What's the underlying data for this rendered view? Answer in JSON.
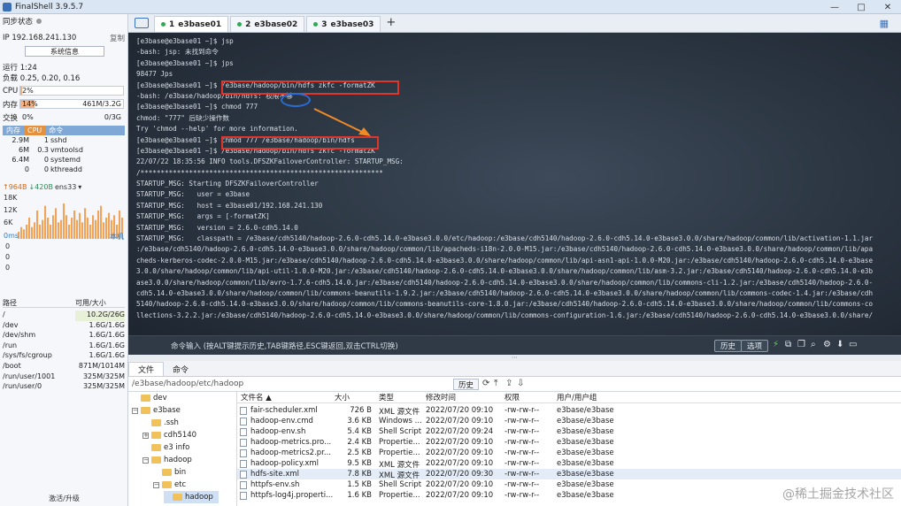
{
  "window": {
    "title": "FinalShell 3.9.5.7",
    "controls": [
      "—",
      "□",
      "✕"
    ]
  },
  "left_panel": {
    "sync_status": "同步状态",
    "ip": "IP 192.168.241.130",
    "copy": "复制",
    "sysinfo_button": "系统信息",
    "uptime": "运行 1:24",
    "load": "负载 0.25, 0.20, 0.16",
    "cpu": {
      "label": "CPU",
      "value": "2%",
      "percent": 2
    },
    "mem": {
      "label": "内存",
      "value": "14%",
      "detail": "461M/3.2G",
      "percent": 14
    },
    "swap": {
      "label": "交换",
      "value": "0%",
      "detail": "0/3G",
      "percent": 0
    },
    "proc_headers": [
      "内存",
      "CPU",
      "命令"
    ],
    "processes": [
      {
        "mem": "2.9M",
        "cpu": "1",
        "cmd": "sshd"
      },
      {
        "mem": "6M",
        "cpu": "0.3",
        "cmd": "vmtoolsd"
      },
      {
        "mem": "6.4M",
        "cpu": "0",
        "cmd": "systemd"
      },
      {
        "mem": "0",
        "cpu": "0",
        "cmd": "kthreadd"
      }
    ],
    "net": {
      "up": "↑964B",
      "down": "↓420B",
      "iface": "ens33",
      "dropdown": "▾"
    },
    "chart_labels": [
      "18K",
      "12K",
      "6K"
    ],
    "latency": {
      "label": "0ms",
      "host": "本机",
      "values": [
        "0",
        "0",
        "0"
      ]
    },
    "disk_headers": [
      "路径",
      "可用/大小"
    ],
    "disks": [
      {
        "path": "/",
        "value": "10.2G/26G"
      },
      {
        "path": "/dev",
        "value": "1.6G/1.6G"
      },
      {
        "path": "/dev/shm",
        "value": "1.6G/1.6G"
      },
      {
        "path": "/run",
        "value": "1.6G/1.6G"
      },
      {
        "path": "/sys/fs/cgroup",
        "value": "1.6G/1.6G"
      },
      {
        "path": "/boot",
        "value": "871M/1014M"
      },
      {
        "path": "/run/user/1001",
        "value": "325M/325M"
      },
      {
        "path": "/run/user/0",
        "value": "325M/325M"
      }
    ],
    "upgrade": "激活/升级"
  },
  "tabs": [
    {
      "num": "1",
      "label": "e3base01",
      "active": true
    },
    {
      "num": "2",
      "label": "e3base02",
      "active": false
    },
    {
      "num": "3",
      "label": "e3base03",
      "active": false
    }
  ],
  "terminal": {
    "lines": [
      "[e3base@e3base01 ~]$ jsp",
      "-bash: jsp: 未找到命令",
      "[e3base@e3base01 ~]$ jps",
      "98477 Jps",
      "[e3base@e3base01 ~]$ /e3base/hadoop/bin/hdfs zkfc -formatZK",
      "-bash: /e3base/hadoop/bin/hdfs: 权限不够",
      "[e3base@e3base01 ~]$ chmod 777",
      "chmod: \"777\" 后缺少操作数",
      "Try 'chmod --help' for more information.",
      "[e3base@e3base01 ~]$ chmod 777 /e3base/hadoop/bin/hdfs",
      "[e3base@e3base01 ~]$ /e3base/hadoop/bin/hdfs zkfc -formatZK",
      "22/07/22 18:35:56 INFO tools.DFSZKFailoverController: STARTUP_MSG:",
      "/************************************************************",
      "STARTUP_MSG: Starting DFSZKFailoverController",
      "STARTUP_MSG:   user = e3base",
      "STARTUP_MSG:   host = e3base01/192.168.241.130",
      "STARTUP_MSG:   args = [-formatZK]",
      "STARTUP_MSG:   version = 2.6.0-cdh5.14.0",
      "STARTUP_MSG:   classpath = /e3base/cdh5140/hadoop-2.6.0-cdh5.14.0-e3base3.0.0/etc/hadoop:/e3base/cdh5140/hadoop-2.6.0-cdh5.14.0-e3base3.0.0/share/hadoop/common/lib/activation-1.1.jar",
      ":/e3base/cdh5140/hadoop-2.6.0-cdh5.14.0-e3base3.0.0/share/hadoop/common/lib/apacheds-i18n-2.0.0-M15.jar:/e3base/cdh5140/hadoop-2.6.0-cdh5.14.0-e3base3.0.0/share/hadoop/common/lib/apa",
      "cheds-kerberos-codec-2.0.0-M15.jar:/e3base/cdh5140/hadoop-2.6.0-cdh5.14.0-e3base3.0.0/share/hadoop/common/lib/api-asn1-api-1.0.0-M20.jar:/e3base/cdh5140/hadoop-2.6.0-cdh5.14.0-e3base",
      "3.0.0/share/hadoop/common/lib/api-util-1.0.0-M20.jar:/e3base/cdh5140/hadoop-2.6.0-cdh5.14.0-e3base3.0.0/share/hadoop/common/lib/asm-3.2.jar:/e3base/cdh5140/hadoop-2.6.0-cdh5.14.0-e3b",
      "ase3.0.0/share/hadoop/common/lib/avro-1.7.6-cdh5.14.0.jar:/e3base/cdh5140/hadoop-2.6.0-cdh5.14.0-e3base3.0.0/share/hadoop/common/lib/commons-cli-1.2.jar:/e3base/cdh5140/hadoop-2.6.0-",
      "cdh5.14.0-e3base3.0.0/share/hadoop/common/lib/commons-beanutils-1.9.2.jar:/e3base/cdh5140/hadoop-2.6.0-cdh5.14.0-e3base3.0.0/share/hadoop/common/lib/commons-codec-1.4.jar:/e3base/cdh",
      "5140/hadoop-2.6.0-cdh5.14.0-e3base3.0.0/share/hadoop/common/lib/commons-beanutils-core-1.8.0.jar:/e3base/cdh5140/hadoop-2.6.0-cdh5.14.0-e3base3.0.0/share/hadoop/common/lib/commons-co",
      "llections-3.2.2.jar:/e3base/cdh5140/hadoop-2.6.0-cdh5.14.0-e3base3.0.0/share/hadoop/common/lib/commons-configuration-1.6.jar:/e3base/cdh5140/hadoop-2.6.0-cdh5.14.0-e3base3.0.0/share/"
    ],
    "cmd_prompt": "命令输入 (按ALT键提示历史,TAB键路径,ESC键返回,双击CTRL切换)",
    "history_btn": "历史",
    "options_btn": "选项"
  },
  "bottom_tabs": [
    "文件",
    "命令"
  ],
  "path": "/e3base/hadoop/etc/hadoop",
  "history_label": "历史",
  "tree": [
    {
      "label": "dev",
      "indent": 0,
      "expand": "",
      "sel": false
    },
    {
      "label": "e3base",
      "indent": 0,
      "expand": "−",
      "sel": false
    },
    {
      "label": ".ssh",
      "indent": 1,
      "expand": "",
      "sel": false
    },
    {
      "label": "cdh5140",
      "indent": 1,
      "expand": "+",
      "sel": false
    },
    {
      "label": "e3 info",
      "indent": 1,
      "expand": "",
      "sel": false
    },
    {
      "label": "hadoop",
      "indent": 1,
      "expand": "−",
      "sel": false
    },
    {
      "label": "bin",
      "indent": 2,
      "expand": "",
      "sel": false
    },
    {
      "label": "etc",
      "indent": 2,
      "expand": "−",
      "sel": false
    },
    {
      "label": "hadoop",
      "indent": 3,
      "expand": "",
      "sel": true
    }
  ],
  "file_headers": [
    "文件名 ▲",
    "大小",
    "类型",
    "修改时间",
    "权限",
    "用户/用户组"
  ],
  "files": [
    {
      "name": "fair-scheduler.xml",
      "size": "726 B",
      "type": "XML 源文件",
      "mtime": "2022/07/20 09:10",
      "perm": "-rw-rw-r--",
      "owner": "e3base/e3base",
      "sel": false
    },
    {
      "name": "hadoop-env.cmd",
      "size": "3.6 KB",
      "type": "Windows ...",
      "mtime": "2022/07/20 09:10",
      "perm": "-rw-rw-r--",
      "owner": "e3base/e3base",
      "sel": false
    },
    {
      "name": "hadoop-env.sh",
      "size": "5.4 KB",
      "type": "Shell Script",
      "mtime": "2022/07/20 09:24",
      "perm": "-rw-rw-r--",
      "owner": "e3base/e3base",
      "sel": false
    },
    {
      "name": "hadoop-metrics.pro...",
      "size": "2.4 KB",
      "type": "Propertie...",
      "mtime": "2022/07/20 09:10",
      "perm": "-rw-rw-r--",
      "owner": "e3base/e3base",
      "sel": false
    },
    {
      "name": "hadoop-metrics2.pr...",
      "size": "2.5 KB",
      "type": "Propertie...",
      "mtime": "2022/07/20 09:10",
      "perm": "-rw-rw-r--",
      "owner": "e3base/e3base",
      "sel": false
    },
    {
      "name": "hadoop-policy.xml",
      "size": "9.5 KB",
      "type": "XML 源文件",
      "mtime": "2022/07/20 09:10",
      "perm": "-rw-rw-r--",
      "owner": "e3base/e3base",
      "sel": false
    },
    {
      "name": "hdfs-site.xml",
      "size": "7.8 KB",
      "type": "XML 源文件",
      "mtime": "2022/07/20 09:30",
      "perm": "-rw-rw-r--",
      "owner": "e3base/e3base",
      "sel": true
    },
    {
      "name": "httpfs-env.sh",
      "size": "1.5 KB",
      "type": "Shell Script",
      "mtime": "2022/07/20 09:10",
      "perm": "-rw-rw-r--",
      "owner": "e3base/e3base",
      "sel": false
    },
    {
      "name": "httpfs-log4j.properti...",
      "size": "1.6 KB",
      "type": "Propertie...",
      "mtime": "2022/07/20 09:10",
      "perm": "-rw-rw-r--",
      "owner": "e3base/e3base",
      "sel": false
    }
  ],
  "watermark": "@稀土掘金技术社区",
  "colors": {
    "terminal_bg": "#2a3440",
    "highlight": "#e0352b",
    "annotation": "#2b6cd4",
    "arrow": "#f08a24",
    "accent": "#3b73c0"
  },
  "net_chart_values": [
    3,
    5,
    4,
    6,
    9,
    5,
    7,
    12,
    6,
    8,
    14,
    9,
    6,
    10,
    13,
    7,
    8,
    15,
    10,
    6,
    9,
    12,
    8,
    11,
    7,
    13,
    9,
    6,
    10,
    8,
    12,
    14,
    7,
    9,
    11,
    8,
    10,
    6,
    12,
    9
  ]
}
